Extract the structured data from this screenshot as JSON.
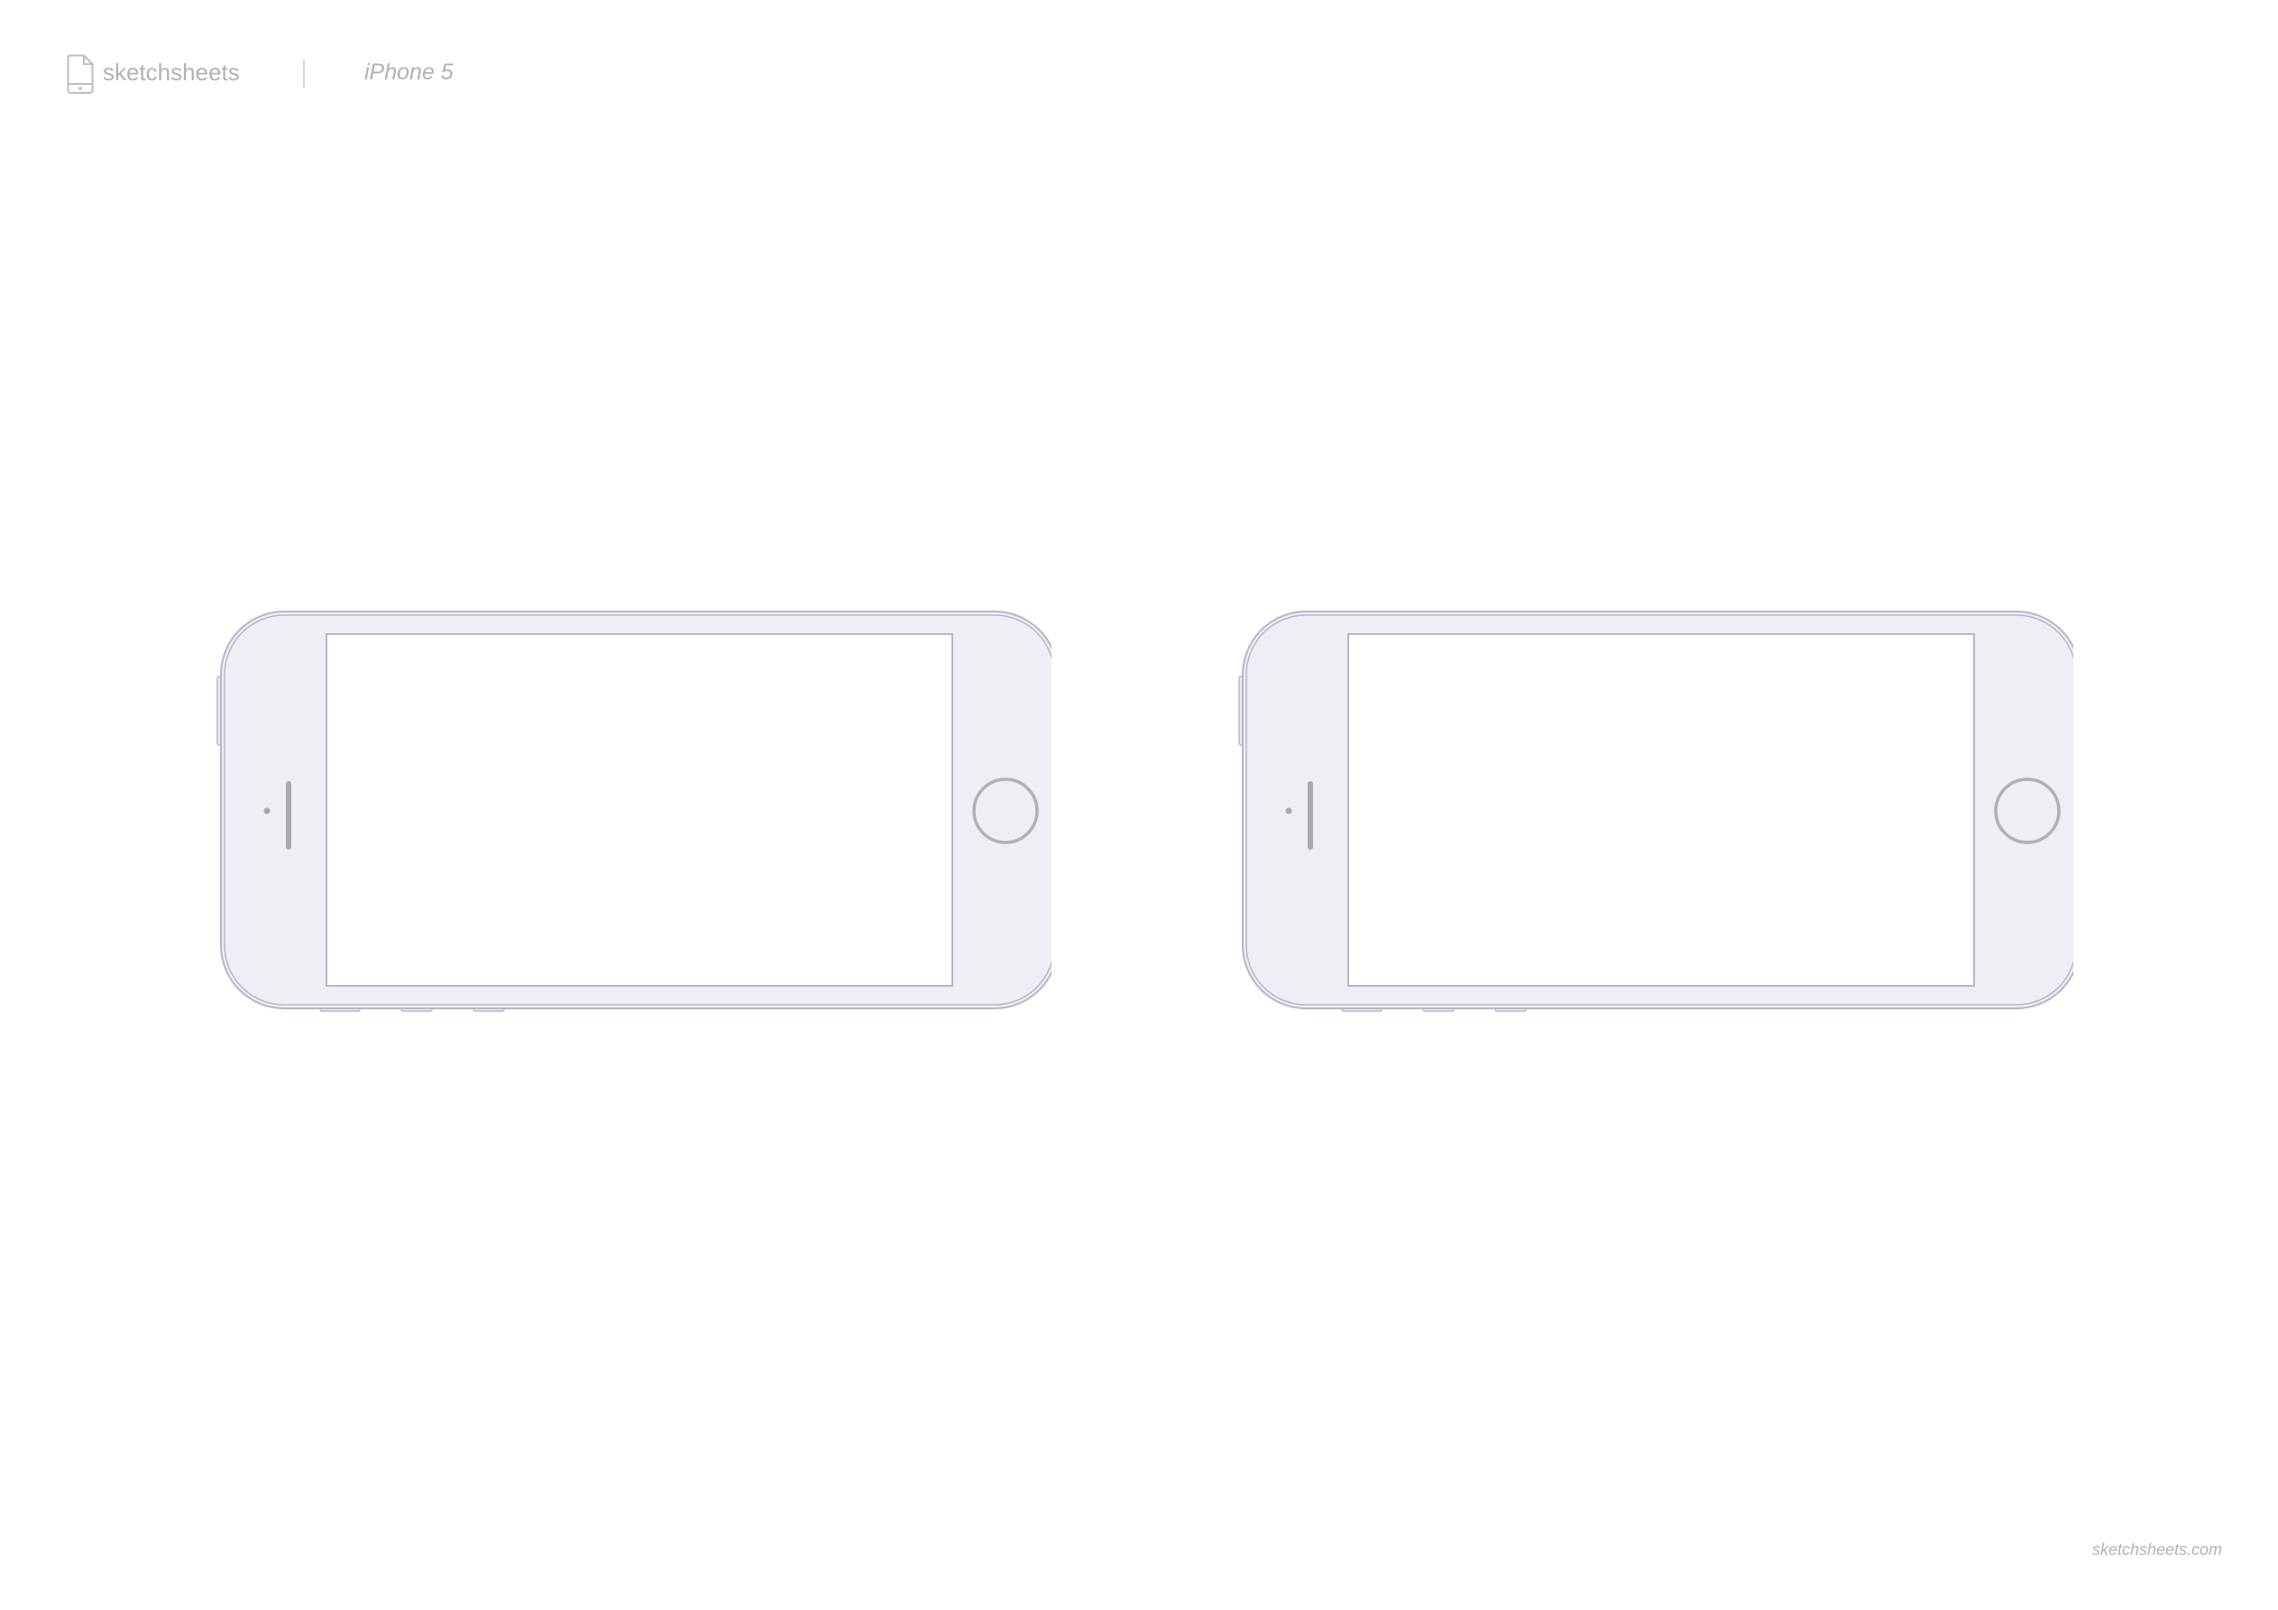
{
  "header": {
    "brand_name": "sketchsheets",
    "device_name": "iPhone 5",
    "brand_icon": "phone-sheet-icon"
  },
  "devices": [
    {
      "model": "iPhone 5",
      "orientation": "landscape"
    },
    {
      "model": "iPhone 5",
      "orientation": "landscape"
    }
  ],
  "colors": {
    "device_body": "#eeeff4",
    "device_outline": "#b7b6c8",
    "screen": "#ffffff",
    "speaker": "#a9a9a9",
    "text": "#b2b2b2"
  },
  "footer": {
    "url": "sketchsheets.com"
  }
}
